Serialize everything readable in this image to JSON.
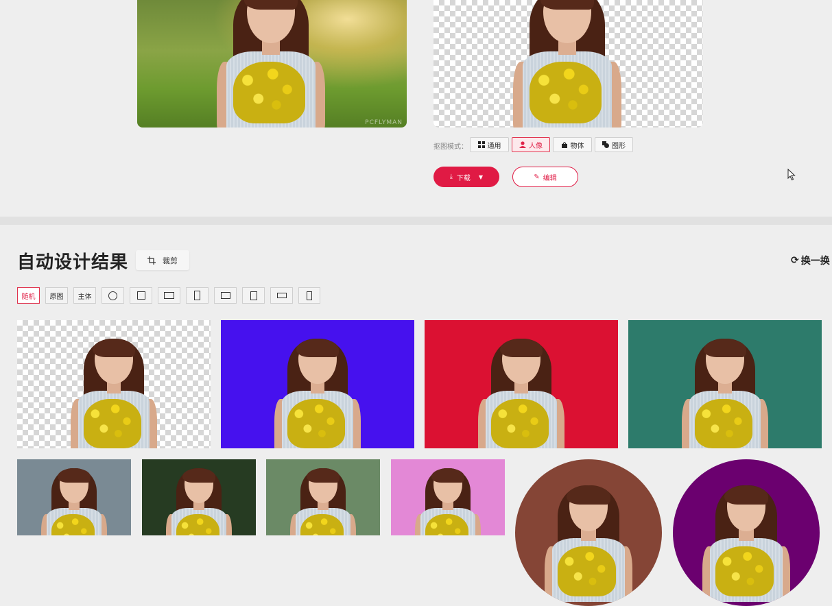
{
  "preview": {
    "watermark": "PCFLYMAN",
    "mode_label": "抠图模式：",
    "modes": [
      {
        "label": "通用",
        "icon": "grid-icon"
      },
      {
        "label": "人像",
        "icon": "person-icon",
        "active": true
      },
      {
        "label": "物体",
        "icon": "bag-icon"
      },
      {
        "label": "图形",
        "icon": "shapes-icon"
      }
    ],
    "download_label": "下载",
    "edit_label": "编辑"
  },
  "auto_design": {
    "title": "自动设计结果",
    "crop_label": "裁剪",
    "refresh_label": "换一换",
    "filters": [
      {
        "label": "随机",
        "active": true
      },
      {
        "label": "原图"
      },
      {
        "label": "主体"
      }
    ],
    "shape_filters": [
      "circle",
      "square",
      "landscape",
      "portrait",
      "landscape",
      "portrait",
      "wide",
      "tall"
    ],
    "backgrounds_row1": [
      "transparent",
      "#4611ee",
      "#db1132",
      "#2d7b6b"
    ],
    "backgrounds_row2": [
      "#7a8a94",
      "#263b22",
      "#6b8a66",
      "#e388d6",
      "#854536",
      "#6b006f"
    ]
  },
  "colors": {
    "accent": "#e01a44",
    "page_bg": "#eeeeee"
  }
}
